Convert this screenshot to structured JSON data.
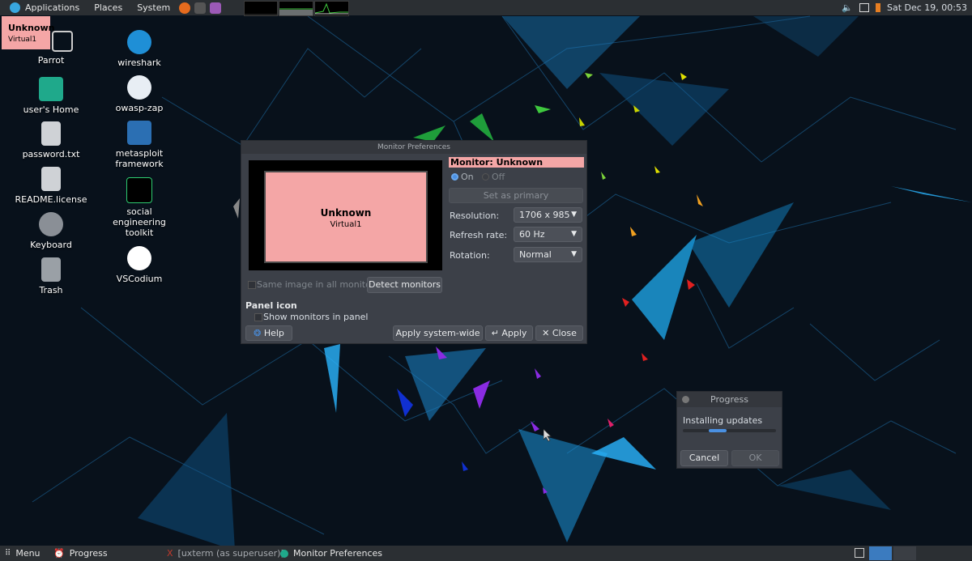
{
  "top_panel": {
    "applications": "Applications",
    "places": "Places",
    "system": "System",
    "clock": "Sat Dec 19, 00:53"
  },
  "monitor_overlay": {
    "name": "Unknown",
    "sub": "Virtual1"
  },
  "desktop_icons": [
    {
      "label": "Parrot"
    },
    {
      "label": "user's Home"
    },
    {
      "label": "password.txt"
    },
    {
      "label": "README.license"
    },
    {
      "label": "Keyboard"
    },
    {
      "label": "Trash"
    },
    {
      "label": "wireshark"
    },
    {
      "label": "owasp-zap"
    },
    {
      "label": "metasploit framework"
    },
    {
      "label": "social engineering toolkit"
    },
    {
      "label": "VSCodium"
    }
  ],
  "dialog": {
    "title": "Monitor Preferences",
    "preview_name": "Unknown",
    "preview_sub": "Virtual1",
    "monitor_header": "Monitor: Unknown",
    "on_label": "On",
    "off_label": "Off",
    "set_primary": "Set as primary",
    "resolution_label": "Resolution:",
    "resolution_value": "1706 x 985",
    "refresh_label": "Refresh rate:",
    "refresh_value": "60 Hz",
    "rotation_label": "Rotation:",
    "rotation_value": "Normal",
    "same_image": "Same image in all monitors",
    "detect": "Detect monitors",
    "panel_icon_heading": "Panel icon",
    "show_monitors": "Show monitors in panel",
    "help": "Help",
    "apply_system": "Apply system-wide",
    "apply": "Apply",
    "close": "Close"
  },
  "progress_window": {
    "title": "Progress",
    "status": "Installing updates",
    "cancel": "Cancel",
    "ok": "OK"
  },
  "bottom_panel": {
    "menu": "Menu",
    "tasks": [
      "Progress",
      "[uxterm (as superuser)]",
      "Monitor Preferences"
    ]
  }
}
